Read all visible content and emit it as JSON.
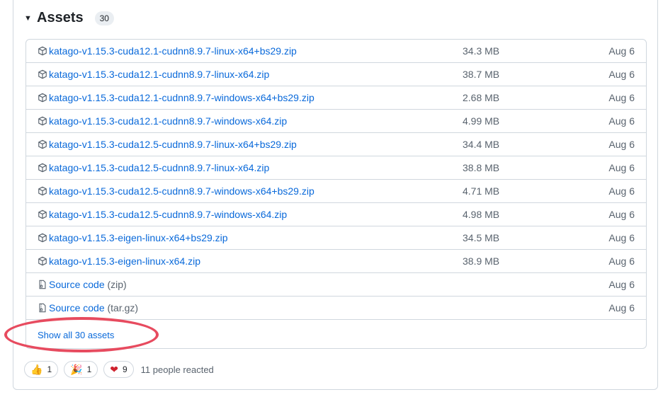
{
  "assets": {
    "title": "Assets",
    "count": "30",
    "rows": [
      {
        "name": "katago-v1.15.3-cuda12.1-cudnn8.9.7-linux-x64+bs29.zip",
        "size": "34.3 MB",
        "date": "Aug 6"
      },
      {
        "name": "katago-v1.15.3-cuda12.1-cudnn8.9.7-linux-x64.zip",
        "size": "38.7 MB",
        "date": "Aug 6"
      },
      {
        "name": "katago-v1.15.3-cuda12.1-cudnn8.9.7-windows-x64+bs29.zip",
        "size": "2.68 MB",
        "date": "Aug 6"
      },
      {
        "name": "katago-v1.15.3-cuda12.1-cudnn8.9.7-windows-x64.zip",
        "size": "4.99 MB",
        "date": "Aug 6"
      },
      {
        "name": "katago-v1.15.3-cuda12.5-cudnn8.9.7-linux-x64+bs29.zip",
        "size": "34.4 MB",
        "date": "Aug 6"
      },
      {
        "name": "katago-v1.15.3-cuda12.5-cudnn8.9.7-linux-x64.zip",
        "size": "38.8 MB",
        "date": "Aug 6"
      },
      {
        "name": "katago-v1.15.3-cuda12.5-cudnn8.9.7-windows-x64+bs29.zip",
        "size": "4.71 MB",
        "date": "Aug 6"
      },
      {
        "name": "katago-v1.15.3-cuda12.5-cudnn8.9.7-windows-x64.zip",
        "size": "4.98 MB",
        "date": "Aug 6"
      },
      {
        "name": "katago-v1.15.3-eigen-linux-x64+bs29.zip",
        "size": "34.5 MB",
        "date": "Aug 6"
      },
      {
        "name": "katago-v1.15.3-eigen-linux-x64.zip",
        "size": "38.9 MB",
        "date": "Aug 6"
      }
    ],
    "source_zip": {
      "label": "Source code",
      "suffix": "(zip)",
      "date": "Aug 6"
    },
    "source_tar": {
      "label": "Source code",
      "suffix": "(tar.gz)",
      "date": "Aug 6"
    },
    "show_all": "Show all 30 assets"
  },
  "reactions": {
    "thumbs_up": "1",
    "tada": "1",
    "heart": "9",
    "summary": "11 people reacted"
  },
  "colors": {
    "link": "#0969da",
    "muted": "#59636e",
    "border": "#d0d7de",
    "highlight": "#e74b5f"
  }
}
